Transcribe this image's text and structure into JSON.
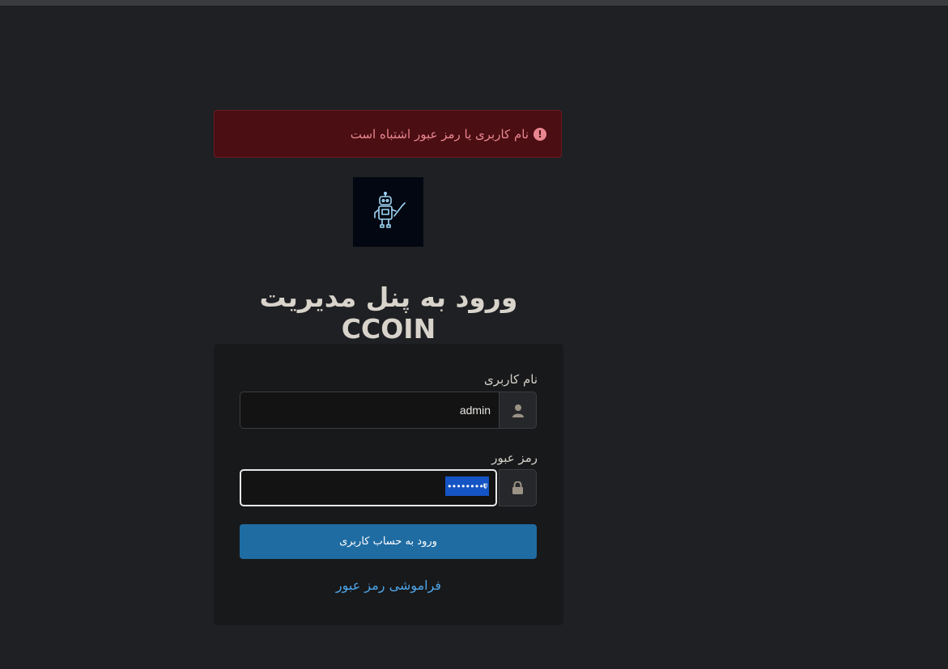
{
  "alert": {
    "icon": "exclamation-circle-icon",
    "message": "نام کاربری یا رمز عبور اشتباه است",
    "color": "#ea868f",
    "background": "#4a0e13"
  },
  "logo": {
    "icon": "robot-icon"
  },
  "page": {
    "title": "ورود به پنل مدیریت CCOIN"
  },
  "form": {
    "username": {
      "label": "نام کاربری",
      "value": "admin",
      "icon": "user-icon"
    },
    "password": {
      "label": "رمز عبور",
      "value": "",
      "icon": "lock-icon",
      "manager_badge": "••••••••"
    },
    "submit_label": "ورود به حساب کاربری",
    "forgot_link": "فراموشی رمز عبور"
  },
  "colors": {
    "accent": "#1f6ca3",
    "link": "#4ea4e6"
  }
}
